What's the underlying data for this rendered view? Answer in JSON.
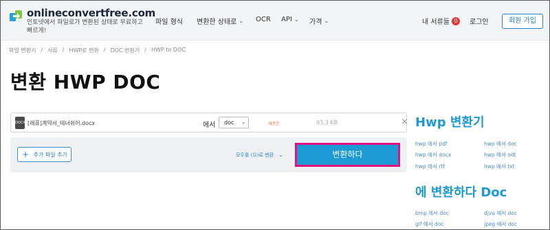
{
  "header": {
    "logo_text": "onlineconvertfree.com",
    "tagline": "인토넷에서 파일로가 변환된 상태로 무료하고 빠르게!",
    "nav": [
      {
        "label": "파일 형식",
        "dropdown": false
      },
      {
        "label": "변환한 상태로",
        "dropdown": true
      },
      {
        "label": "OCR",
        "dropdown": false
      },
      {
        "label": "API",
        "dropdown": true
      },
      {
        "label": "가격",
        "dropdown": true
      }
    ],
    "my_docs_label": "내 서류들",
    "my_docs_count": "0",
    "login_label": "로그인",
    "signup_label": "회원 가입",
    "chevron": "⌄"
  },
  "breadcrumb": [
    "파일 변환기",
    "서류",
    "HWP로 변환",
    "DOC 변환기",
    "HWP to DOC"
  ],
  "breadcrumb_sep": "/",
  "page_title": "변환 HWP DOC",
  "file": {
    "icon_label": "DOCX",
    "name": "[레퓨]계약서_테너쉬어.docx",
    "to_label": "에서",
    "format": "doc",
    "status": "새로운",
    "size": "93.3 KB",
    "remove": "×"
  },
  "actions": {
    "add_plus": "+",
    "add_label": "추가 파일 추가",
    "convert_all_label": "모두를 (으)로 변환",
    "convert_label": "변환하다"
  },
  "sidebar": {
    "heading1": "Hwp 변환기",
    "links1": [
      "hwp 에서 pdf",
      "hwp 에서 doc",
      "hwp 에서 docx",
      "hwp 에서 odt",
      "hwp 에서 rtf",
      "hwp 에서 txt"
    ],
    "heading2": "에 변환하다 Doc",
    "links2": [
      "bmp 에서 doc",
      "djvu 에서 doc",
      "gif 에서 doc",
      "jpeg 에서 doc"
    ]
  },
  "colors": {
    "accent": "#1c9ad6",
    "highlight_border": "#e4117e",
    "badge": "#e53935",
    "status": "#e87a3a"
  }
}
